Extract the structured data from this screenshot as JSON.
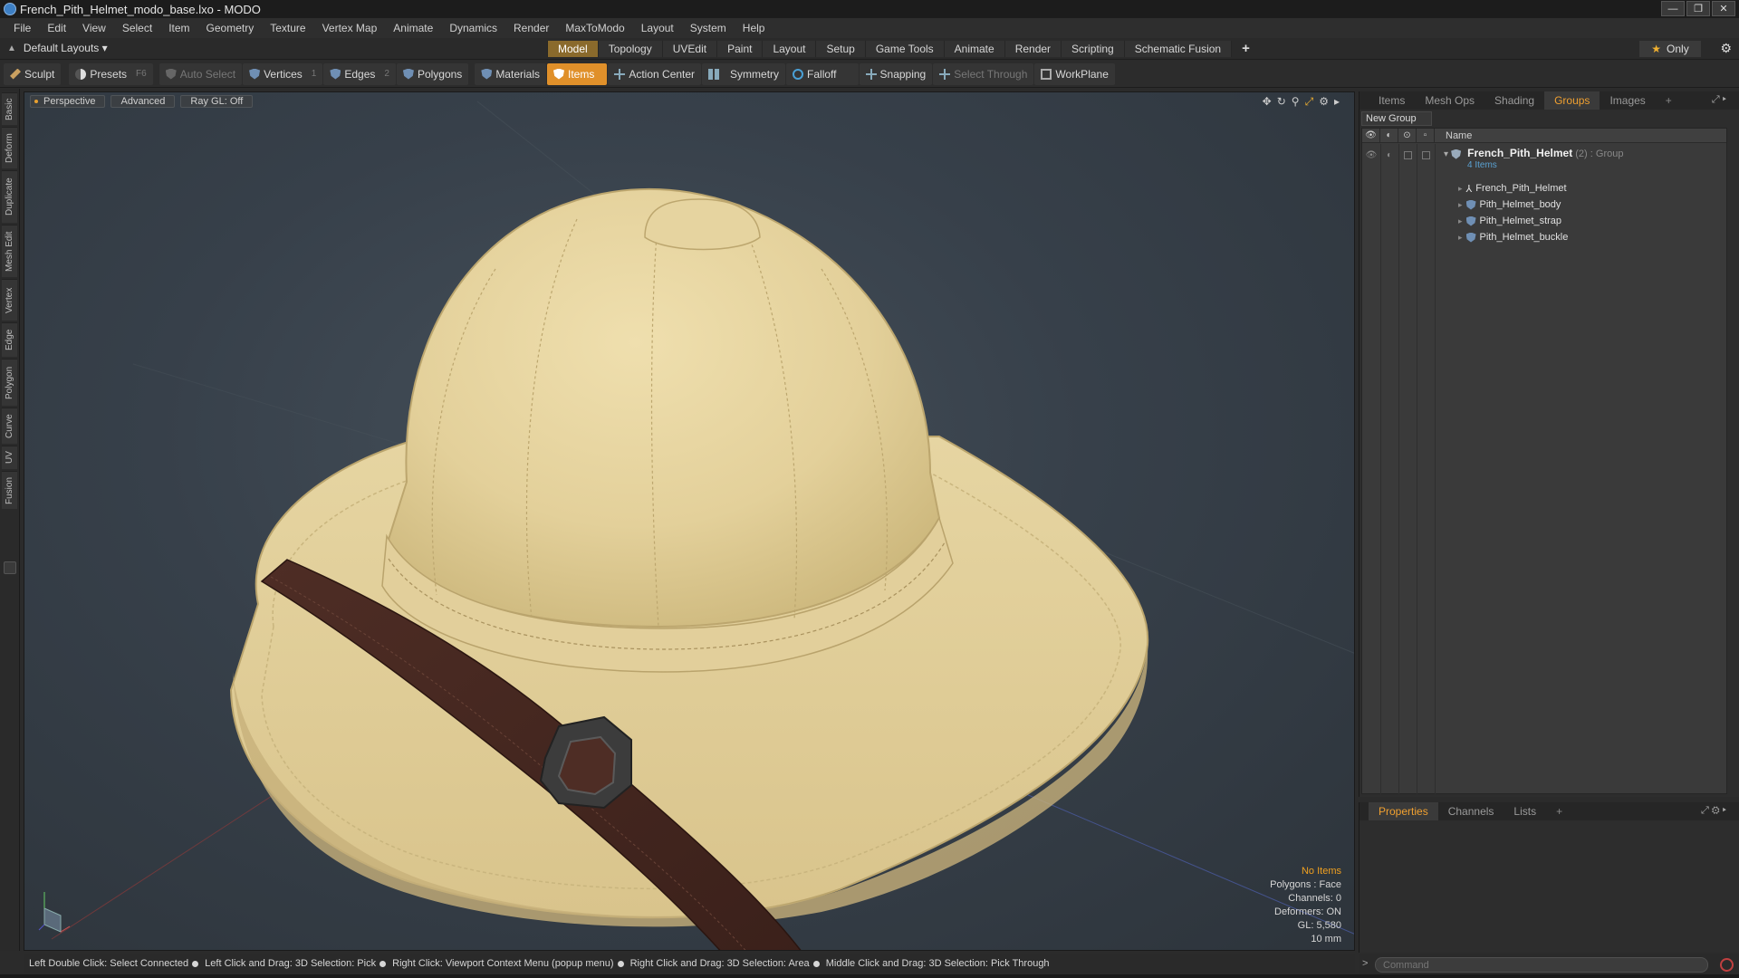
{
  "window": {
    "title": "French_Pith_Helmet_modo_base.lxo - MODO",
    "buttons": [
      "—",
      "❐",
      "✕"
    ]
  },
  "menu": [
    "File",
    "Edit",
    "View",
    "Select",
    "Item",
    "Geometry",
    "Texture",
    "Vertex Map",
    "Animate",
    "Dynamics",
    "Render",
    "MaxToModo",
    "Layout",
    "System",
    "Help"
  ],
  "layout": {
    "selector": "Default Layouts ▾",
    "tabs": [
      "Model",
      "Topology",
      "UVEdit",
      "Paint",
      "Layout",
      "Setup",
      "Game Tools",
      "Animate",
      "Render",
      "Scripting",
      "Schematic Fusion"
    ],
    "active_tab": "Model",
    "add": "+",
    "only": "Only"
  },
  "toolbar": {
    "sculpt": "Sculpt",
    "presets": "Presets",
    "presets_key": "F6",
    "auto_select": "Auto Select",
    "vertices": "Vertices",
    "vertices_count": "1",
    "edges": "Edges",
    "edges_count": "2",
    "polygons": "Polygons",
    "materials": "Materials",
    "items": "Items",
    "action_center": "Action Center",
    "symmetry": "Symmetry",
    "falloff": "Falloff",
    "snapping": "Snapping",
    "select_through": "Select Through",
    "workplane": "WorkPlane"
  },
  "left_tabs": [
    "Basic",
    "Deform",
    "Duplicate",
    "Mesh Edit",
    "Vertex",
    "Edge",
    "Polygon",
    "Curve",
    "UV",
    "Fusion"
  ],
  "viewport": {
    "view": "Perspective",
    "shading": "Advanced",
    "raygl": "Ray GL: Off",
    "info": {
      "no_items": "No Items",
      "polygons": "Polygons : Face",
      "channels": "Channels: 0",
      "deformers": "Deformers: ON",
      "gl": "GL: 5,580",
      "unit": "10 mm"
    }
  },
  "status": {
    "hints": [
      "Left Double Click: Select Connected",
      "Left Click and Drag: 3D Selection: Pick",
      "Right Click: Viewport Context Menu (popup menu)",
      "Right Click and Drag: 3D Selection: Area",
      "Middle Click and Drag: 3D Selection: Pick Through"
    ]
  },
  "right_panel": {
    "tabs": [
      "Items",
      "Mesh Ops",
      "Shading",
      "Groups",
      "Images"
    ],
    "active_tab": "Groups",
    "add": "+",
    "new_group": "New Group",
    "column_name": "Name",
    "group": {
      "name": "French_Pith_Helmet",
      "count": "(2)",
      "type": ": Group",
      "sub": "4 Items"
    },
    "items": [
      "French_Pith_Helmet",
      "Pith_Helmet_body",
      "Pith_Helmet_strap",
      "Pith_Helmet_buckle"
    ]
  },
  "properties_panel": {
    "tabs": [
      "Properties",
      "Channels",
      "Lists"
    ],
    "active_tab": "Properties",
    "add": "+"
  },
  "command": {
    "placeholder": "Command"
  },
  "colors": {
    "accent": "#e0902a",
    "active_tab_text": "#f0a030",
    "helmet": "#e8d7a4",
    "strap": "#4a2a22"
  }
}
